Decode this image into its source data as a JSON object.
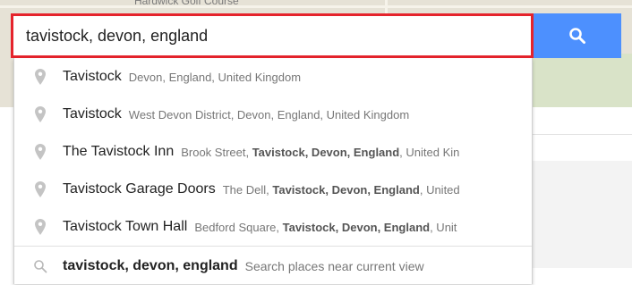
{
  "map": {
    "label": "Hardwick Golf Course"
  },
  "search": {
    "value": "tavistock, devon, england",
    "button_icon": "search-icon"
  },
  "suggestions": [
    {
      "name": "Tavistock",
      "detail": "Devon, England, United Kingdom"
    },
    {
      "name": "Tavistock",
      "detail": "West Devon District, Devon, England, United Kingdom"
    },
    {
      "name": "The Tavistock Inn",
      "detail_plain": "Brook Street, ",
      "detail_bold": "Tavistock, Devon, England",
      "detail_tail": ", United Kin"
    },
    {
      "name": "Tavistock Garage Doors",
      "detail_plain": "The Dell, ",
      "detail_bold": "Tavistock, Devon, England",
      "detail_tail": ", United"
    },
    {
      "name": "Tavistock Town Hall",
      "detail_plain": "Bedford Square, ",
      "detail_bold": "Tavistock, Devon, England",
      "detail_tail": ", Unit"
    }
  ],
  "query_row": {
    "query": "tavistock, devon, england",
    "hint": "Search places near current view"
  },
  "colors": {
    "accent": "#4d90fe",
    "highlight": "#e5242c"
  }
}
